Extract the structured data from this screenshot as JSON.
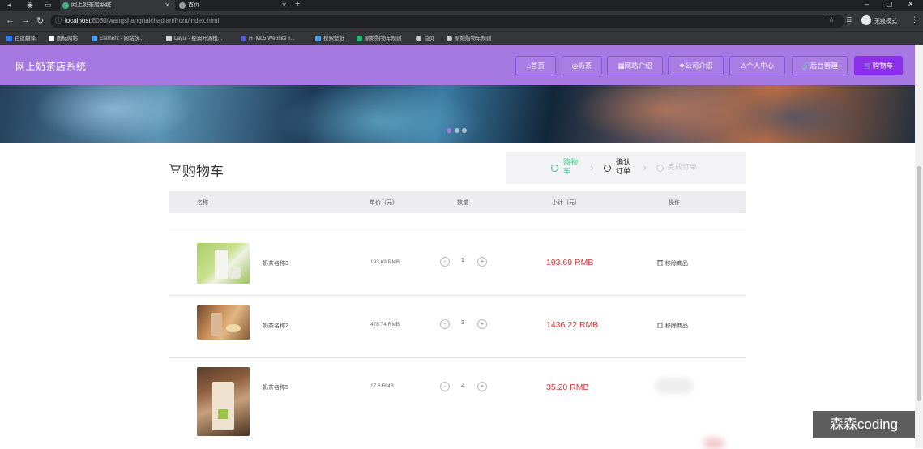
{
  "browser": {
    "tabs": [
      {
        "title": "网上奶茶店系统",
        "icon_color": "#41b883"
      },
      {
        "title": "首页",
        "icon_color": "#9aa0a6"
      }
    ],
    "url_host": "localhost",
    "url_path": ":8080/wangshangnaichadian/front/index.html",
    "profile_label": "无痕模式",
    "bookmarks": [
      {
        "label": "百度翻译",
        "icon_color": "#2f7df6"
      },
      {
        "label": "图标网站",
        "icon_color": "#ffffff"
      },
      {
        "label": "Element - 网站快...",
        "icon_color": "#409eff"
      },
      {
        "label": "Layui - 经典开源模...",
        "icon_color": "#d0d0d0"
      },
      {
        "label": "HTML5 Website T...",
        "icon_color": "#5b5bd6"
      },
      {
        "label": "搜索壁纸",
        "icon_color": "#4a9de8"
      },
      {
        "label": "原始购物车规则",
        "icon_color": "#2bb673"
      },
      {
        "label": "首页",
        "icon_color": "#cccccc"
      },
      {
        "label": "原始购物车规则",
        "icon_color": "#cccccc"
      }
    ]
  },
  "header": {
    "site_title": "网上奶茶店系统",
    "nav": [
      {
        "label": "⌂首页",
        "active": false
      },
      {
        "label": "◎奶茶",
        "active": false
      },
      {
        "label": "▦网站介绍",
        "active": false
      },
      {
        "label": "❖公司介绍",
        "active": false
      },
      {
        "label": "♙个人中心",
        "active": false
      },
      {
        "label": "🔗后台管理",
        "active": false
      },
      {
        "label": "🛒购物车",
        "active": true
      }
    ]
  },
  "cart": {
    "title": "购物车",
    "steps": [
      {
        "label": "购物车",
        "state": "done"
      },
      {
        "label": "确认订单",
        "state": "current"
      },
      {
        "label": "完成订单",
        "state": "todo"
      }
    ],
    "columns": {
      "name": "名称",
      "price": "单价（元）",
      "quantity": "数量",
      "subtotal": "小计（元）",
      "action": "操作"
    },
    "items": [
      {
        "name": "奶茶名称3",
        "price": "193.69 RMB",
        "qty": "1",
        "subtotal": "193.69 RMB",
        "remove": "移除商品"
      },
      {
        "name": "奶茶名称2",
        "price": "478.74 RMB",
        "qty": "3",
        "subtotal": "1436.22 RMB",
        "remove": "移除商品"
      },
      {
        "name": "奶茶名称5",
        "price": "17.6 RMB",
        "qty": "2",
        "subtotal": "35.20 RMB",
        "remove": "移除商品"
      }
    ]
  },
  "watermark": "森森coding",
  "colors": {
    "brand": "#a678e2",
    "active_nav": "#8b2fe8",
    "subtotal": "#d9333a",
    "step_done": "#41c089"
  }
}
